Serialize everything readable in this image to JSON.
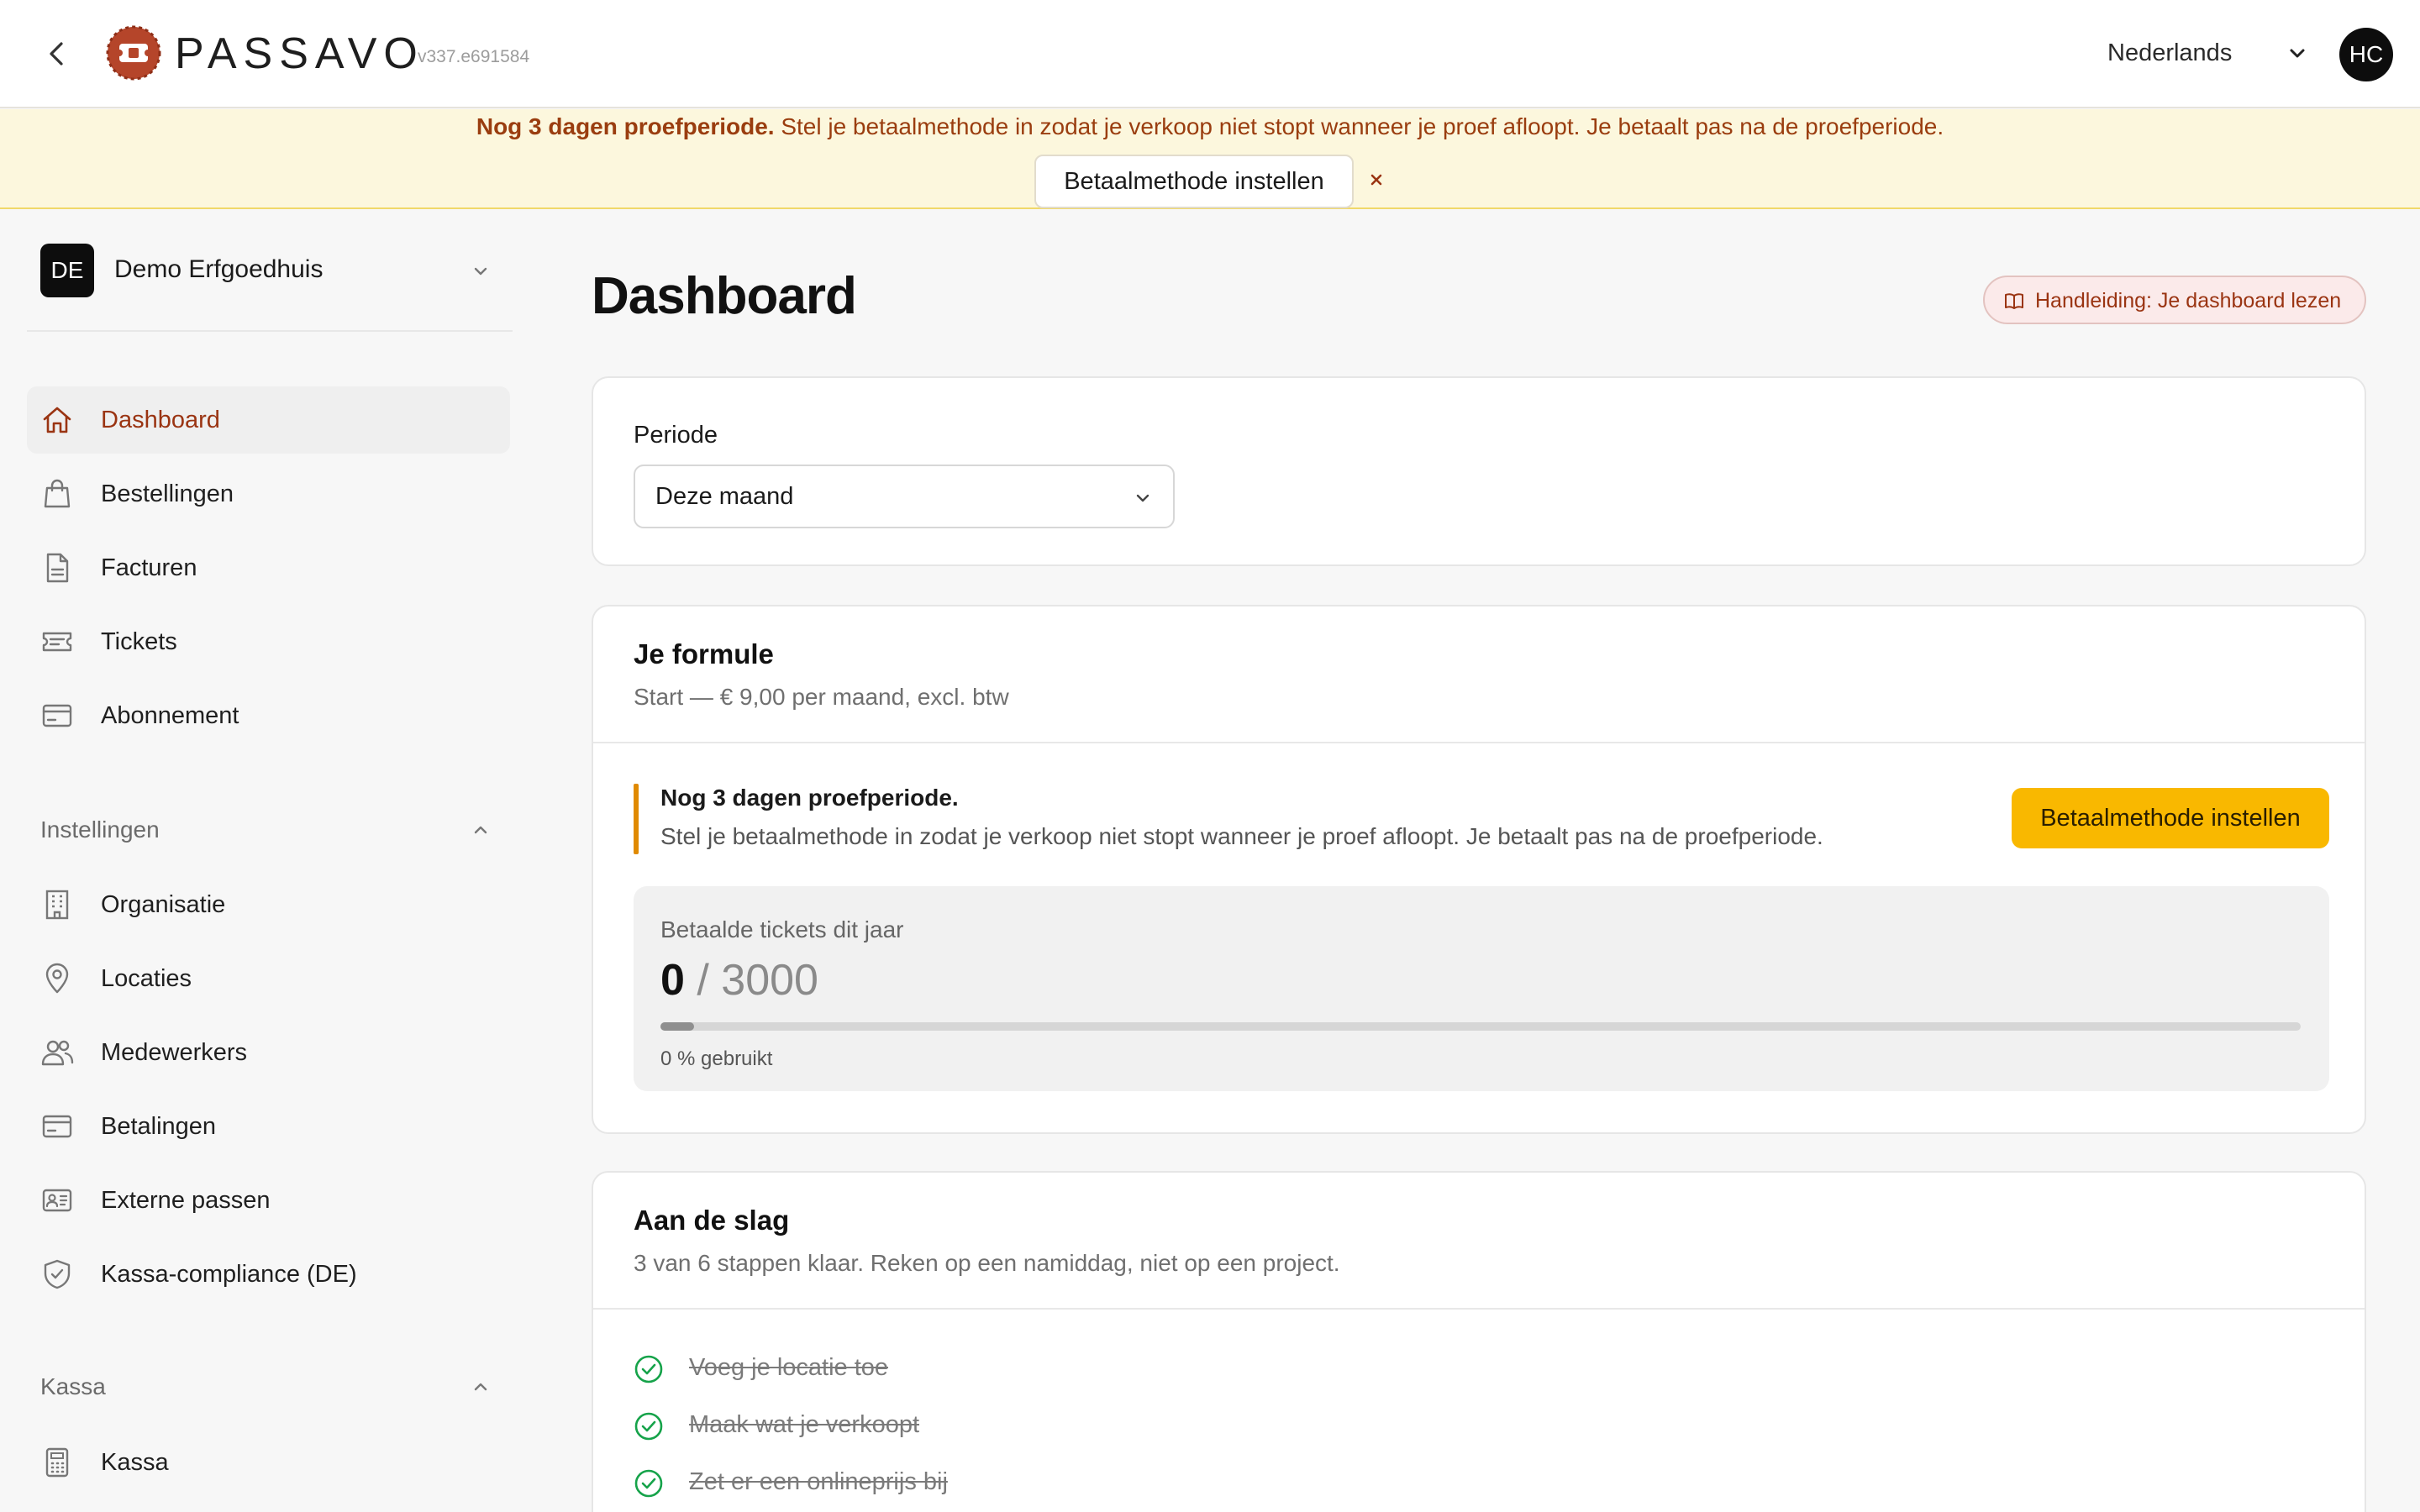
{
  "app": {
    "brand": "PASSAVO",
    "version": "v337.e691584",
    "language": "Nederlands",
    "user_initials": "HC"
  },
  "trial_banner": {
    "title": "Nog 3 dagen proefperiode.",
    "message": "Stel je betaalmethode in zodat je verkoop niet stopt wanneer je proef afloopt. Je betaalt pas na de proefperiode.",
    "button": "Betaalmethode instellen",
    "close": "×"
  },
  "sidebar": {
    "org_initials": "DE",
    "org_name": "Demo Erfgoedhuis",
    "main_items": [
      {
        "label": "Dashboard",
        "icon": "home-icon",
        "active": true
      },
      {
        "label": "Bestellingen",
        "icon": "shopping-bag-icon"
      },
      {
        "label": "Facturen",
        "icon": "file-icon"
      },
      {
        "label": "Tickets",
        "icon": "ticket-icon"
      },
      {
        "label": "Abonnement",
        "icon": "credit-card-icon"
      }
    ],
    "settings_section": "Instellingen",
    "settings_items": [
      {
        "label": "Organisatie",
        "icon": "building-icon"
      },
      {
        "label": "Locaties",
        "icon": "map-pin-icon"
      },
      {
        "label": "Medewerkers",
        "icon": "users-icon"
      },
      {
        "label": "Betalingen",
        "icon": "credit-card-icon"
      },
      {
        "label": "Externe passen",
        "icon": "id-card-icon"
      },
      {
        "label": "Kassa-compliance (DE)",
        "icon": "shield-check-icon"
      }
    ],
    "pos_section": "Kassa",
    "pos_items": [
      {
        "label": "Kassa",
        "icon": "calculator-icon"
      }
    ]
  },
  "main": {
    "title": "Dashboard",
    "guide_button": "Handleiding: Je dashboard lezen",
    "period": {
      "label": "Periode",
      "value": "Deze maand"
    },
    "formula": {
      "title": "Je formule",
      "subtitle": "Start — € 9,00 per maand, excl. btw",
      "notice_title": "Nog 3 dagen proefperiode.",
      "notice_text": "Stel je betaalmethode in zodat je verkoop niet stopt wanneer je proef afloopt. Je betaalt pas na de proefperiode.",
      "pay_button": "Betaalmethode instellen",
      "usage_label": "Betaalde tickets dit jaar",
      "usage_current": "0",
      "usage_separator": "/",
      "usage_max": "3000",
      "usage_fraction": 0,
      "usage_percent_text": "0 % gebruikt"
    },
    "getting_started": {
      "title": "Aan de slag",
      "subtitle": "3 van 6 stappen klaar. Reken op een namiddag, niet op een project.",
      "steps": [
        {
          "label": "Voeg je locatie toe",
          "done": true
        },
        {
          "label": "Maak wat je verkoopt",
          "done": true
        },
        {
          "label": "Zet er een onlineprijs bij",
          "done": true
        }
      ]
    }
  },
  "colors": {
    "accent": "#9a3412",
    "trial_bg": "#fcf7dd",
    "pay_button": "#f9b800",
    "step_done": "#16a34a",
    "logo": "#b5452a"
  }
}
